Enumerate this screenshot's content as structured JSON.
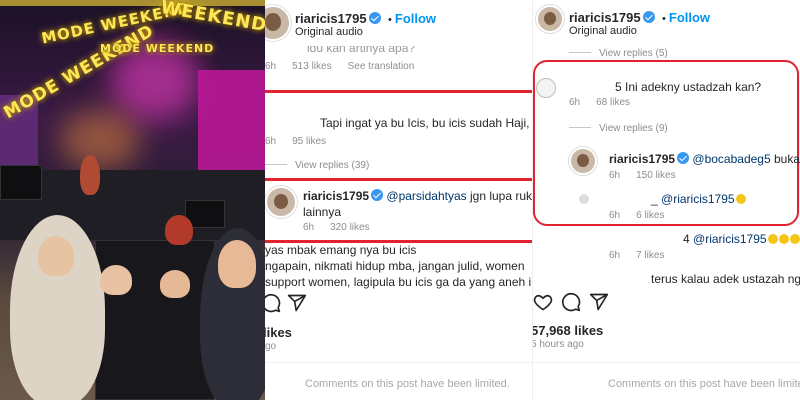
{
  "video": {
    "arch_text_1": "MODE WEEKEND",
    "arch_text_2": "MODE WEEKEND",
    "arch_text_3": "MODE WEEKEND",
    "arch_text_4": "WEEKEND"
  },
  "panel2": {
    "header": {
      "username": "riaricis1795",
      "follow": "Follow",
      "subtitle": "Original audio"
    },
    "comments": [
      {
        "text": "idu kan artinya apa?",
        "time": "6h",
        "likes": "513 likes",
        "action": "See translation"
      },
      {
        "text": "Tapi ingat ya bu Icis, bu icis sudah Haji,",
        "time": "6h",
        "likes": "95 likes"
      },
      {
        "view_replies": "View replies (39)"
      },
      {
        "username": "riaricis1795",
        "mention": "@parsidahtyas",
        "text": "jgn lupa rukun islam",
        "text2": "lainnya",
        "time": "6h",
        "likes": "320 likes"
      },
      {
        "text": "yas mbak emang nya bu icis",
        "text2": "ngapain, nikmati hidup mba, jangan julid, women",
        "text3": "support women, lagipula bu icis ga da yang aneh i"
      }
    ],
    "footer": {
      "likes": "likes",
      "ago": "go",
      "limited": "Comments on this post have been limited."
    }
  },
  "panel3": {
    "header": {
      "username": "riaricis1795",
      "follow": "Follow",
      "subtitle": "Original audio"
    },
    "view_replies_1": "View replies (5)",
    "comments": [
      {
        "text": "5 Ini adekny ustadzah kan?",
        "time": "6h",
        "likes": "68 likes"
      },
      {
        "view_replies": "View replies (9)"
      },
      {
        "username": "riaricis1795",
        "mention": "@bocabadeg5",
        "text": "bukan",
        "time": "6h",
        "likes": "150 likes"
      },
      {
        "prefix": "_",
        "mention": "@riaricis1795",
        "time": "6h",
        "likes": "6 likes"
      },
      {
        "prefix": "4",
        "mention": "@riaricis1795",
        "time": "6h",
        "likes": "7 likes"
      },
      {
        "text": "terus kalau adek ustazah ngapa"
      }
    ],
    "footer": {
      "likes": "57,968 likes",
      "ago": "5 hours ago",
      "limited": "Comments on this post have been limited."
    }
  },
  "colors": {
    "highlight": "#e0232e",
    "follow": "#0095f6",
    "verified": "#3897f0"
  },
  "icons": [
    "heart-icon",
    "comment-icon",
    "share-icon",
    "verified-icon"
  ]
}
